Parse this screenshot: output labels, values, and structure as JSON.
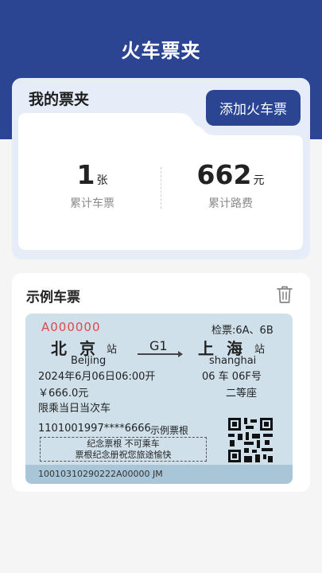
{
  "header": {
    "title": "火车票夹"
  },
  "wallet": {
    "heading": "我的票夹",
    "add_button": "添加火车票",
    "stats": [
      {
        "value": "1",
        "unit": "张",
        "label": "累计车票"
      },
      {
        "value": "662",
        "unit": "元",
        "label": "累计路费"
      }
    ]
  },
  "sample": {
    "title": "示例车票",
    "ticket": {
      "serial": "A000000",
      "gate": "检票:6A、6B",
      "from_cn": "北京",
      "from_zhan": "站",
      "from_en": "Beijing",
      "train_no": "G1",
      "to_cn": "上海",
      "to_zhan": "站",
      "to_en": "shanghai",
      "datetime": "2024年6月06日06:00开",
      "car_seat": "06 车 06F号",
      "price": "￥666.0元",
      "seat_class": "二等座",
      "limit": "限乘当日当次车",
      "id_number": "1101001997****6666",
      "passenger": "示例票根",
      "memo_line1": "纪念票根 不可乘车",
      "memo_line2": "票根纪念册祝您旅途愉快",
      "footer_code": "10010310290222A00000 JM"
    }
  },
  "colors": {
    "primary": "#2b4593",
    "ticket_bg": "#cfe0ea",
    "serial_red": "#e0474a"
  }
}
